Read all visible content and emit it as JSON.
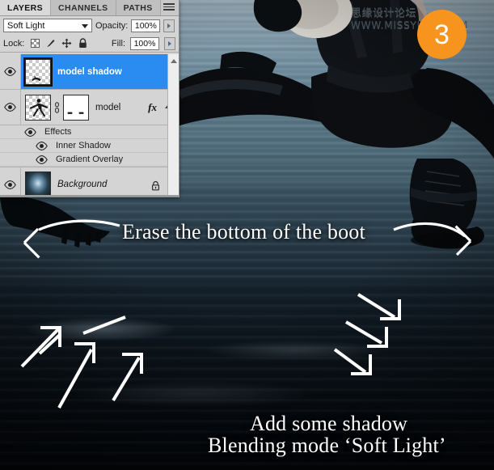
{
  "app": {
    "panel_title": "Layers Panel"
  },
  "panel": {
    "tabs": [
      {
        "label": "LAYERS",
        "active": true
      },
      {
        "label": "CHANNELS",
        "active": false
      },
      {
        "label": "PATHS",
        "active": false
      }
    ],
    "menu_icon": "panel-menu-icon",
    "blend_mode": {
      "value": "Soft Light",
      "caret_icon": "chevron-down-icon"
    },
    "opacity": {
      "label": "Opacity:",
      "value": "100%",
      "stepper_icon": "spinner-arrow-icon"
    },
    "fill": {
      "label": "Fill:",
      "value": "100%",
      "stepper_icon": "spinner-arrow-icon"
    },
    "lock": {
      "label": "Lock:",
      "icons": [
        "lock-transparent-pixels-icon",
        "lock-image-pixels-icon",
        "lock-position-icon",
        "lock-all-icon"
      ]
    },
    "layers": [
      {
        "name": "model shadow",
        "selected": true,
        "visible": true,
        "thumb": "transparent-checker",
        "has_mask": false,
        "has_fx": false,
        "locked": false
      },
      {
        "name": "model",
        "selected": false,
        "visible": true,
        "thumb": "transparent-checker",
        "has_mask": true,
        "has_fx": true,
        "fx_label": "fx",
        "locked": false,
        "effects": {
          "group_label": "Effects",
          "items": [
            "Inner Shadow",
            "Gradient Overlay"
          ]
        }
      },
      {
        "name": "Background",
        "selected": false,
        "visible": true,
        "thumb": "water-image",
        "has_mask": false,
        "has_fx": false,
        "locked": true,
        "lock_icon": "padlock-icon"
      }
    ],
    "scrollbar": {
      "name": "vertical-scrollbar",
      "arrow_icon": "scroll-up-arrow-icon"
    }
  },
  "annotations": {
    "erase": "Erase the bottom of the boot",
    "add_shadow": "Add some shadow",
    "blending": "Blending mode ‘Soft Light’"
  },
  "watermark": {
    "chinese": "思缘设计论坛",
    "url": "WWW.MISSYUAN.COM"
  },
  "badge": {
    "number": "3",
    "color": "#f7941e"
  },
  "arrows": {
    "left_curve": "curved-arrow-left",
    "right_curve": "curved-arrow-right",
    "up_arrows": [
      "arrow-up-right-1",
      "arrow-up-right-2",
      "arrow-up-right-3"
    ],
    "down_arrows": [
      "arrow-down-right-1",
      "arrow-down-right-2",
      "arrow-down-right-3"
    ]
  },
  "colors": {
    "accent_selection": "#2a8cf0",
    "badge_orange": "#f7941e",
    "panel_bg": "#d4d4d4",
    "annotation_text": "#ffffff"
  }
}
